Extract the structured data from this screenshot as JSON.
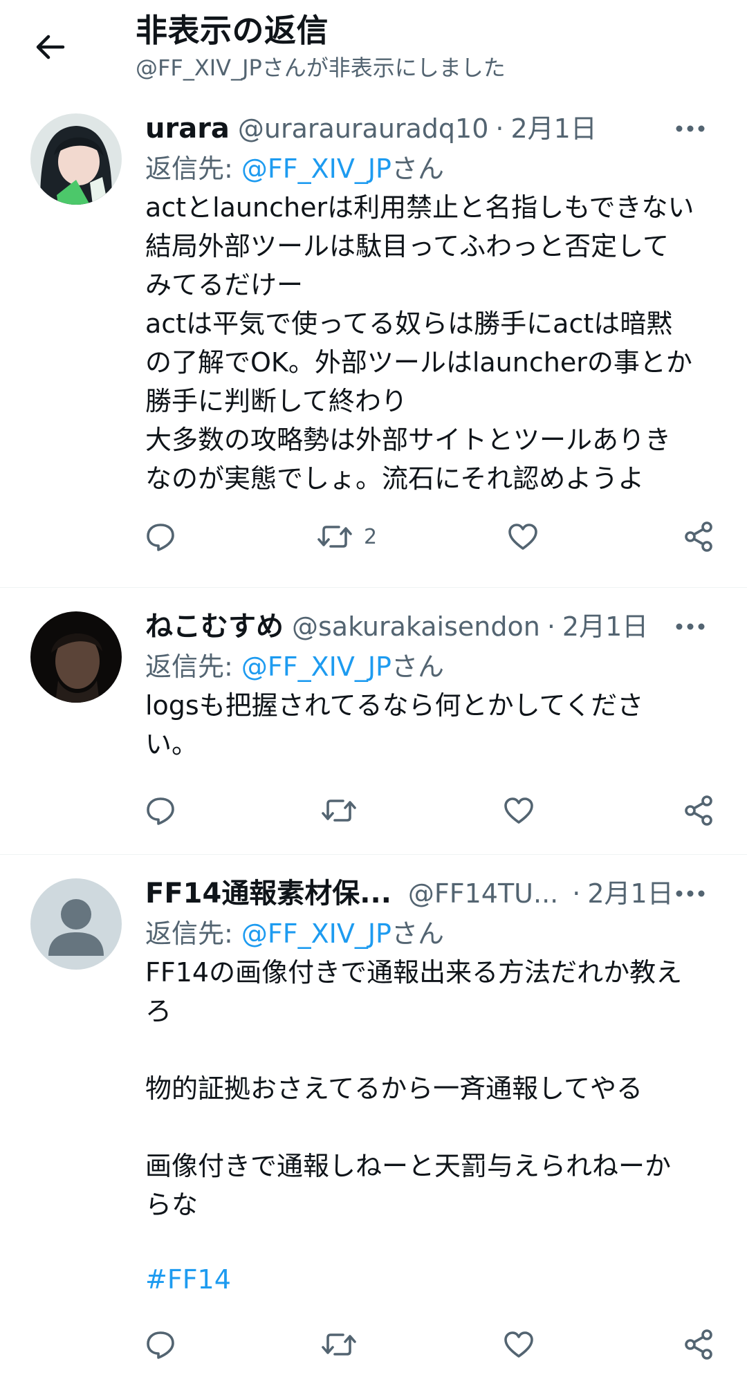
{
  "header": {
    "title": "非表示の返信",
    "subtitle": "@FF_XIV_JPさんが非表示にしました",
    "back_icon": "arrow-left-icon"
  },
  "colors": {
    "text": "#0f1419",
    "secondary": "#536471",
    "accent": "#1d9bf0",
    "divider": "#eff3f4"
  },
  "tweets": [
    {
      "display_name": "urara",
      "handle": "@uraraurauradq10",
      "separator": "·",
      "date": "2月1日",
      "reply_prefix": "返信先: ",
      "reply_mention": "@FF_XIV_JP",
      "reply_suffix": "さん",
      "text": "actとlauncherは利用禁止と名指しもできない\n結局外部ツールは駄目ってふわっと否定して\nみてるだけー\nactは平気で使ってる奴らは勝手にactは暗黙\nの了解でOK。外部ツールはlauncherの事とか\n勝手に判断して終わり\n大多数の攻略勢は外部サイトとツールありき\nなのが実態でしょ。流石にそれ認めようよ",
      "retweet_count": "2"
    },
    {
      "display_name": "ねこむすめ",
      "handle": "@sakurakaisendon",
      "separator": "·",
      "date": "2月1日",
      "reply_prefix": "返信先: ",
      "reply_mention": "@FF_XIV_JP",
      "reply_suffix": "さん",
      "text": "logsも把握されてるなら何とかしてくださ\nい。",
      "retweet_count": ""
    },
    {
      "display_name": "FF14通報素材保...",
      "handle": "@FF14TU...",
      "separator": "·",
      "date": "2月1日",
      "reply_prefix": "返信先: ",
      "reply_mention": "@FF_XIV_JP",
      "reply_suffix": "さん",
      "text": "FF14の画像付きで通報出来る方法だれか教え\nろ\n\n物的証拠おさえてるから一斉通報してやる\n\n画像付きで通報しねーと天罰与えられねーか\nらな",
      "hashtag": "#FF14",
      "retweet_count": ""
    }
  ]
}
